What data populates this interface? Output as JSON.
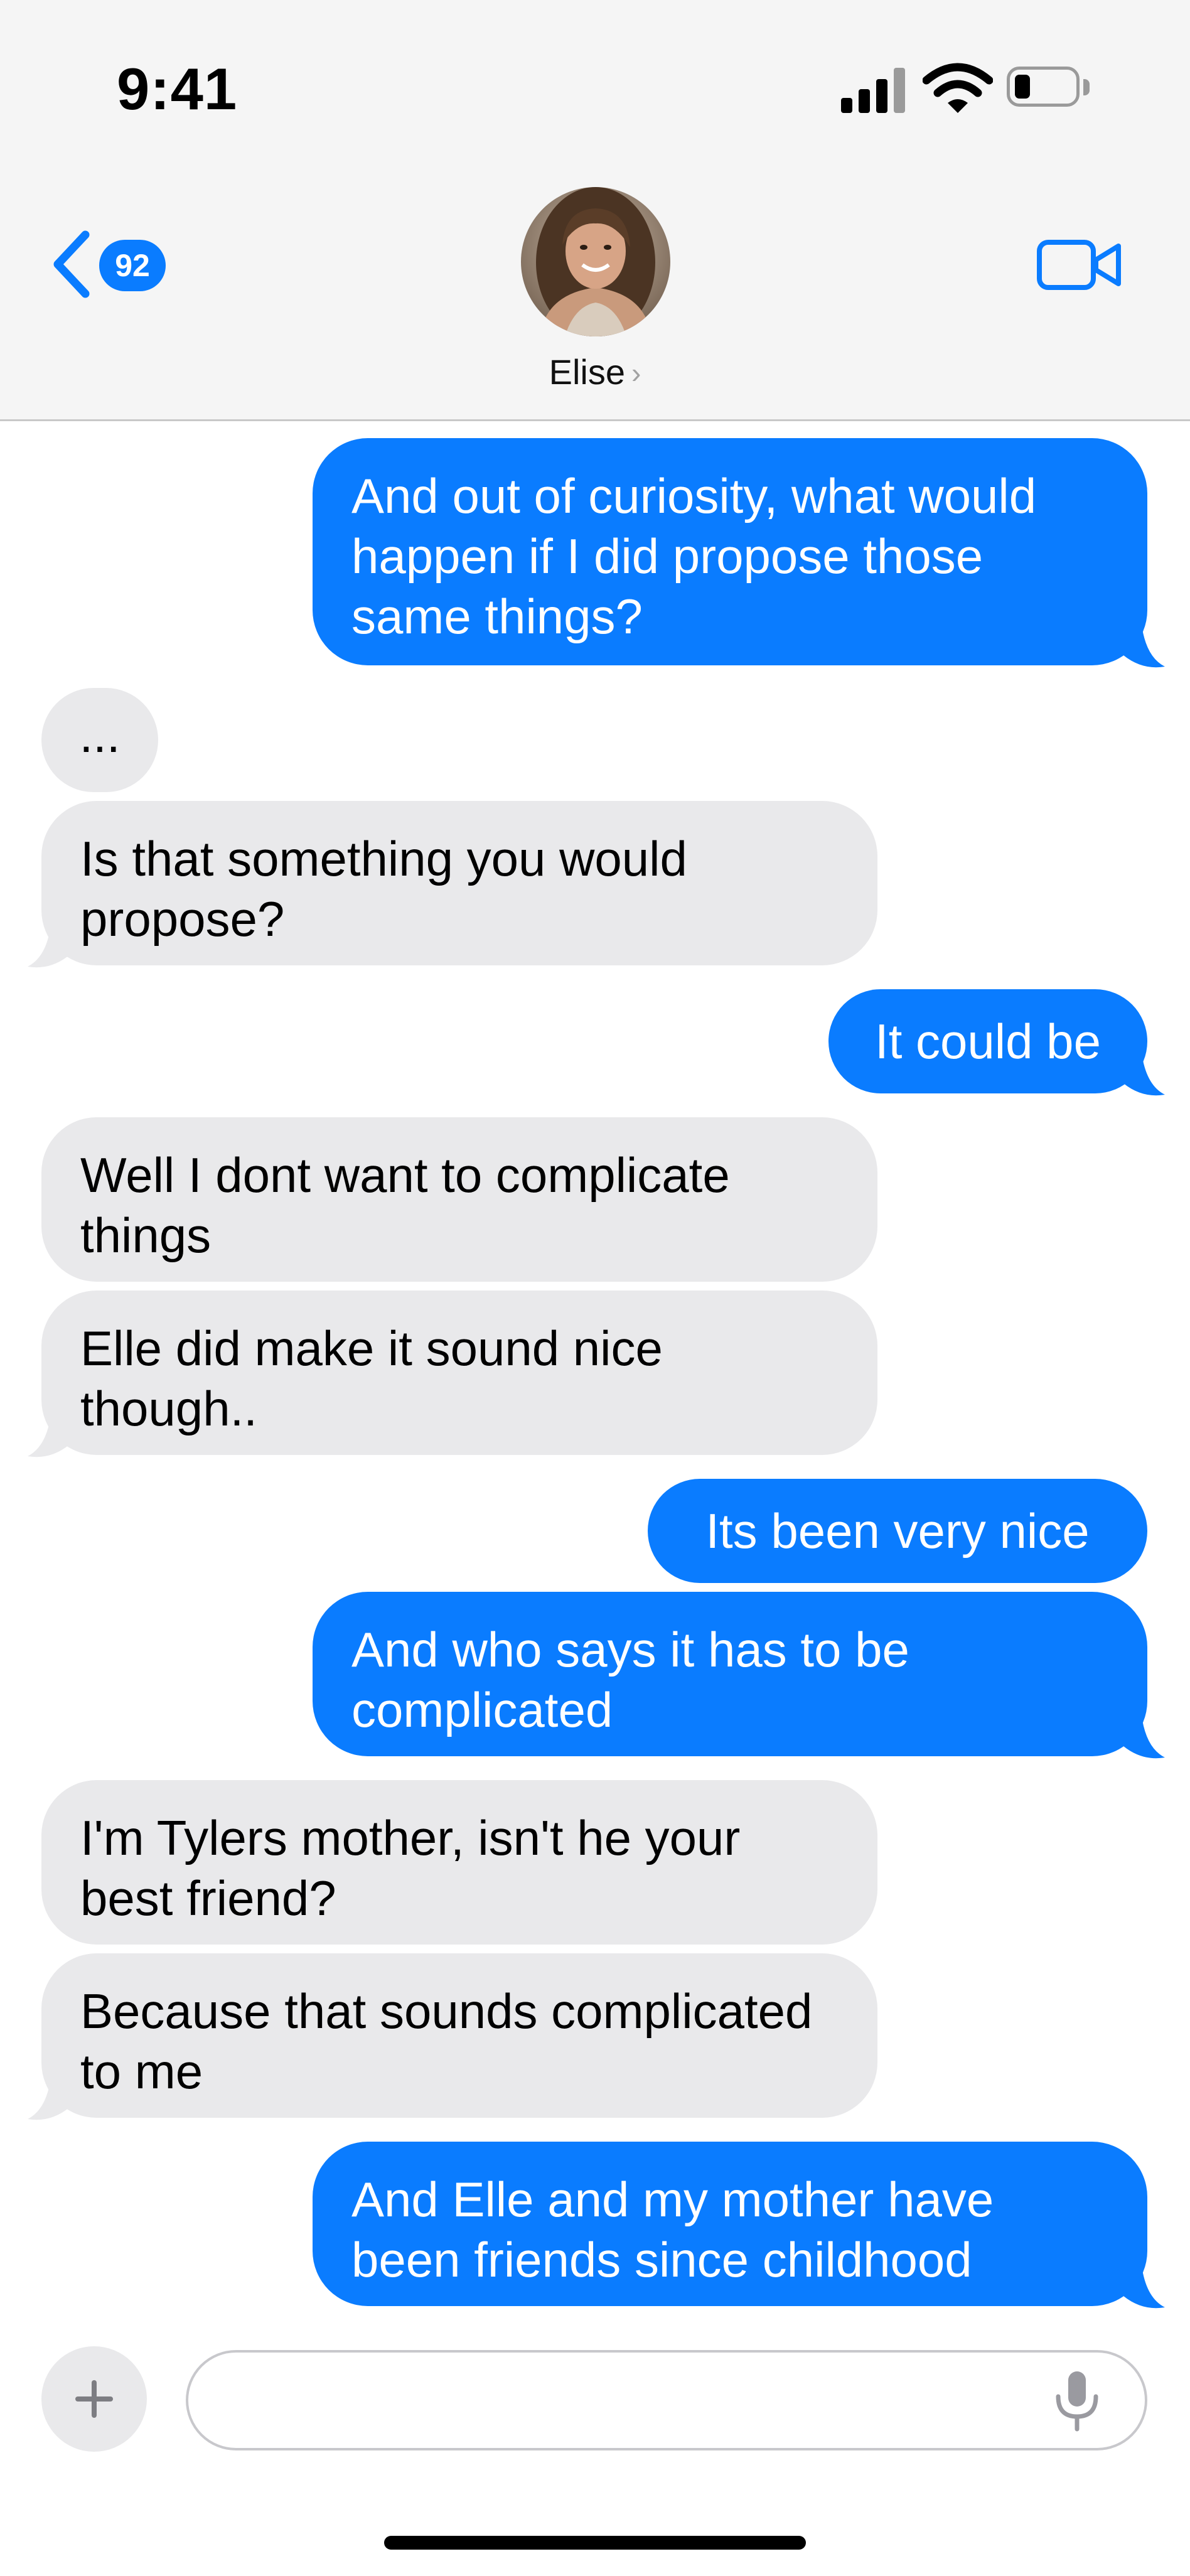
{
  "status_bar": {
    "time": "9:41"
  },
  "header": {
    "unread_count": "92",
    "contact_name": "Elise",
    "contact_chevron": "›",
    "icons": [
      "back-chevron-icon",
      "avatar",
      "video-camera-icon"
    ]
  },
  "messages": [
    {
      "from": "me",
      "text": "And out of curiosity, what would happen if I did propose those same things?"
    },
    {
      "from": "them",
      "text": "..."
    },
    {
      "from": "them",
      "text": "Is that something you would propose?"
    },
    {
      "from": "me",
      "text": "It could be"
    },
    {
      "from": "them",
      "text": "Well I dont want to complicate things"
    },
    {
      "from": "them",
      "text": "Elle did make it sound nice though.."
    },
    {
      "from": "me",
      "text": "Its been very nice"
    },
    {
      "from": "me",
      "text": "And who says it has to be complicated"
    },
    {
      "from": "them",
      "text": "I'm Tylers mother, isn't he your best friend?"
    },
    {
      "from": "them",
      "text": "Because that sounds complicated to me"
    },
    {
      "from": "me",
      "text": "And Elle and my mother have been friends since childhood"
    }
  ],
  "composer": {
    "placeholder": "",
    "icons": [
      "plus-icon",
      "microphone-icon"
    ]
  },
  "colors": {
    "outgoing": "#0a7cff",
    "incoming": "#e9e9eb",
    "header_bg": "#f5f5f5"
  }
}
